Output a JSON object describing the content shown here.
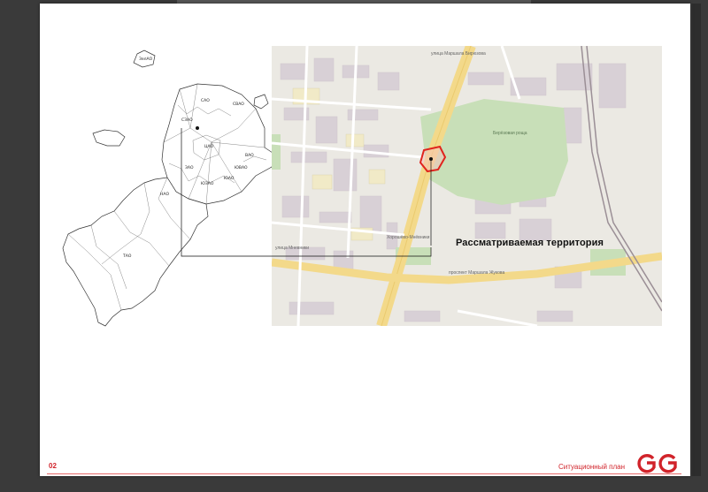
{
  "document": {
    "page_number": "02",
    "section_title": "Ситуационный план",
    "brand": "GG"
  },
  "locator_map": {
    "district_labels": [
      "ЗелАО",
      "СЗАО",
      "САО",
      "СВАО",
      "ВАО",
      "ЦАО",
      "ЗАО",
      "ЮЗАО",
      "ЮАО",
      "ЮВАО",
      "НАО",
      "ТАО"
    ]
  },
  "site_map": {
    "annotation": "Рассматриваемая территория",
    "street_labels": [
      "улица Маршала Бирюзова",
      "проспект Маршала Жукова",
      "Берёзовая роща",
      "Хорошёво-Мнёвники",
      "улица Мневники"
    ],
    "highlight_color": "#e0241d"
  },
  "colors": {
    "accent": "#d1232a",
    "map_base": "#ecebe5",
    "map_green": "#c9dfb7",
    "map_road_major": "#f6df9e",
    "map_block": "#d9d2d7"
  }
}
